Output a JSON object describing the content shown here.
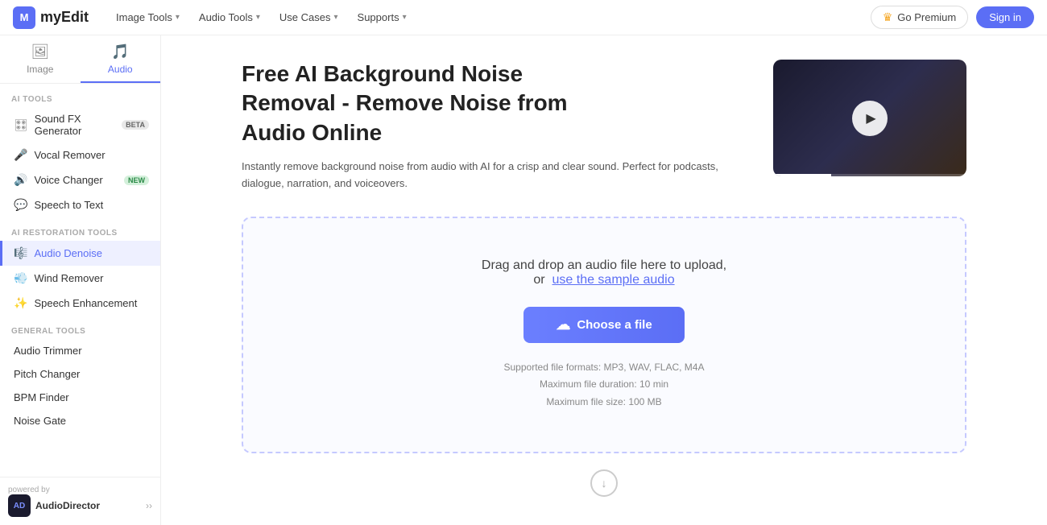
{
  "logo": {
    "icon_label": "M",
    "text": "myEdit"
  },
  "nav": {
    "items": [
      {
        "label": "Image Tools",
        "id": "image-tools"
      },
      {
        "label": "Audio Tools",
        "id": "audio-tools"
      },
      {
        "label": "Use Cases",
        "id": "use-cases"
      },
      {
        "label": "Supports",
        "id": "supports"
      }
    ],
    "premium_label": "Go Premium",
    "signin_label": "Sign in"
  },
  "sidebar": {
    "tabs": [
      {
        "label": "Image",
        "id": "image-tab"
      },
      {
        "label": "Audio",
        "id": "audio-tab",
        "active": true
      }
    ],
    "ai_tools_label": "AI TOOLS",
    "ai_tools": [
      {
        "label": "Sound FX Generator",
        "badge": "BETA",
        "id": "sound-fx"
      },
      {
        "label": "Vocal Remover",
        "badge": "",
        "id": "vocal-remover"
      },
      {
        "label": "Voice Changer",
        "badge": "NEW",
        "id": "voice-changer"
      },
      {
        "label": "Speech to Text",
        "badge": "",
        "id": "speech-to-text"
      }
    ],
    "restoration_label": "AI RESTORATION TOOLS",
    "restoration_tools": [
      {
        "label": "Audio Denoise",
        "id": "audio-denoise",
        "active": true
      },
      {
        "label": "Wind Remover",
        "id": "wind-remover"
      },
      {
        "label": "Speech Enhancement",
        "id": "speech-enhancement"
      }
    ],
    "general_label": "GENERAL TOOLS",
    "general_tools": [
      {
        "label": "Audio Trimmer",
        "id": "audio-trimmer"
      },
      {
        "label": "Pitch Changer",
        "id": "pitch-changer"
      },
      {
        "label": "BPM Finder",
        "id": "bpm-finder"
      },
      {
        "label": "Noise Gate",
        "id": "noise-gate"
      }
    ],
    "powered_by_label": "powered by",
    "audiodirector_label": "AudioDirector"
  },
  "hero": {
    "title_line1": "Free AI Background Noise",
    "title_line2": "Removal - Remove Noise from",
    "title_line3": "Audio Online",
    "description": "Instantly remove background noise from audio with AI for a crisp and clear sound. Perfect for podcasts, dialogue, narration, and voiceovers."
  },
  "upload": {
    "drag_text": "Drag and drop an audio file here to upload,",
    "or_text": "or",
    "sample_link_text": "use the sample audio",
    "button_label": "Choose a file",
    "formats_label": "Supported file formats: MP3, WAV, FLAC, M4A",
    "duration_label": "Maximum file duration: 10 min",
    "size_label": "Maximum file size: 100 MB"
  },
  "colors": {
    "accent": "#5b6ef5",
    "text_primary": "#222",
    "text_secondary": "#555",
    "border": "#eee"
  }
}
